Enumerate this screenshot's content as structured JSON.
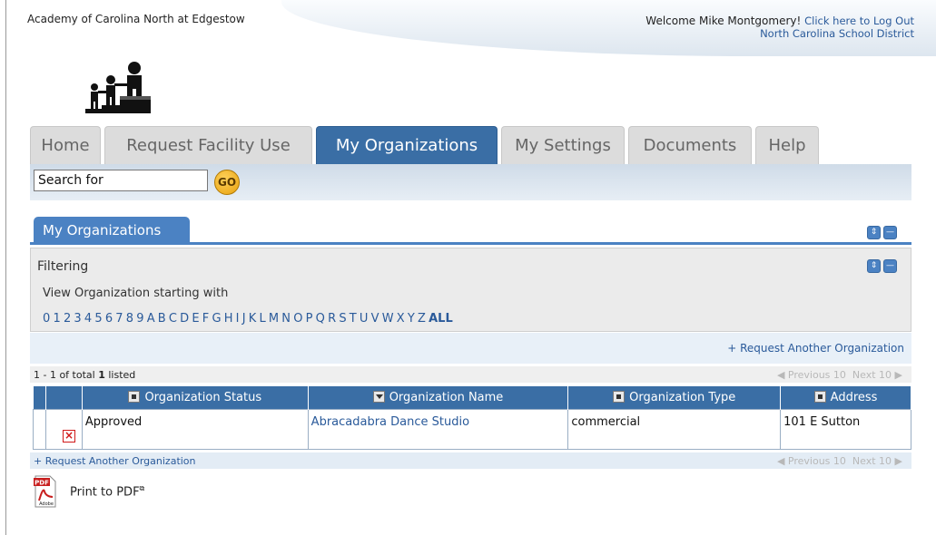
{
  "header": {
    "school_name": "Academy of Carolina North at Edgestow",
    "welcome": "Welcome Mike Montgomery!",
    "logout_link": "Click here to Log Out",
    "district_link": "North Carolina School District"
  },
  "tabs": [
    {
      "label": "Home"
    },
    {
      "label": "Request Facility Use"
    },
    {
      "label": "My Organizations"
    },
    {
      "label": "My Settings"
    },
    {
      "label": "Documents"
    },
    {
      "label": "Help"
    }
  ],
  "search": {
    "value": "Search for",
    "go_label": "GO"
  },
  "panel": {
    "title": "My Organizations",
    "filter_title": "Filtering",
    "filter_desc": "View Organization starting with",
    "letters": [
      "0",
      "1",
      "2",
      "3",
      "4",
      "5",
      "6",
      "7",
      "8",
      "9",
      "A",
      "B",
      "C",
      "D",
      "E",
      "F",
      "G",
      "H",
      "I",
      "J",
      "K",
      "L",
      "M",
      "N",
      "O",
      "P",
      "Q",
      "R",
      "S",
      "T",
      "U",
      "V",
      "W",
      "X",
      "Y",
      "Z"
    ],
    "all_label": "ALL",
    "request_link": "+ Request Another Organization",
    "pager_prefix": "1 - 1 of total ",
    "pager_count": "1",
    "pager_suffix": " listed",
    "prev_label": "Previous 10",
    "next_label": "Next 10",
    "bottom_request_link": "+ Request Another Organization",
    "pdf_label": "Print to PDF",
    "pdf_icon_text": "PDF",
    "pdf_sub_text": "Adobe"
  },
  "table": {
    "columns": [
      "Organization Status",
      "Organization Name",
      "Organization Type",
      "Address"
    ],
    "rows": [
      {
        "status": "Approved",
        "name": "Abracadabra Dance Studio",
        "type": "commercial",
        "address": "101 E Sutton"
      }
    ]
  },
  "colors": {
    "tab_active": "#3a6ea5",
    "panel_accent": "#4b82c3",
    "link": "#2a5a9a",
    "delete_icon": "#d01818",
    "go_button": "#e7a10e"
  }
}
